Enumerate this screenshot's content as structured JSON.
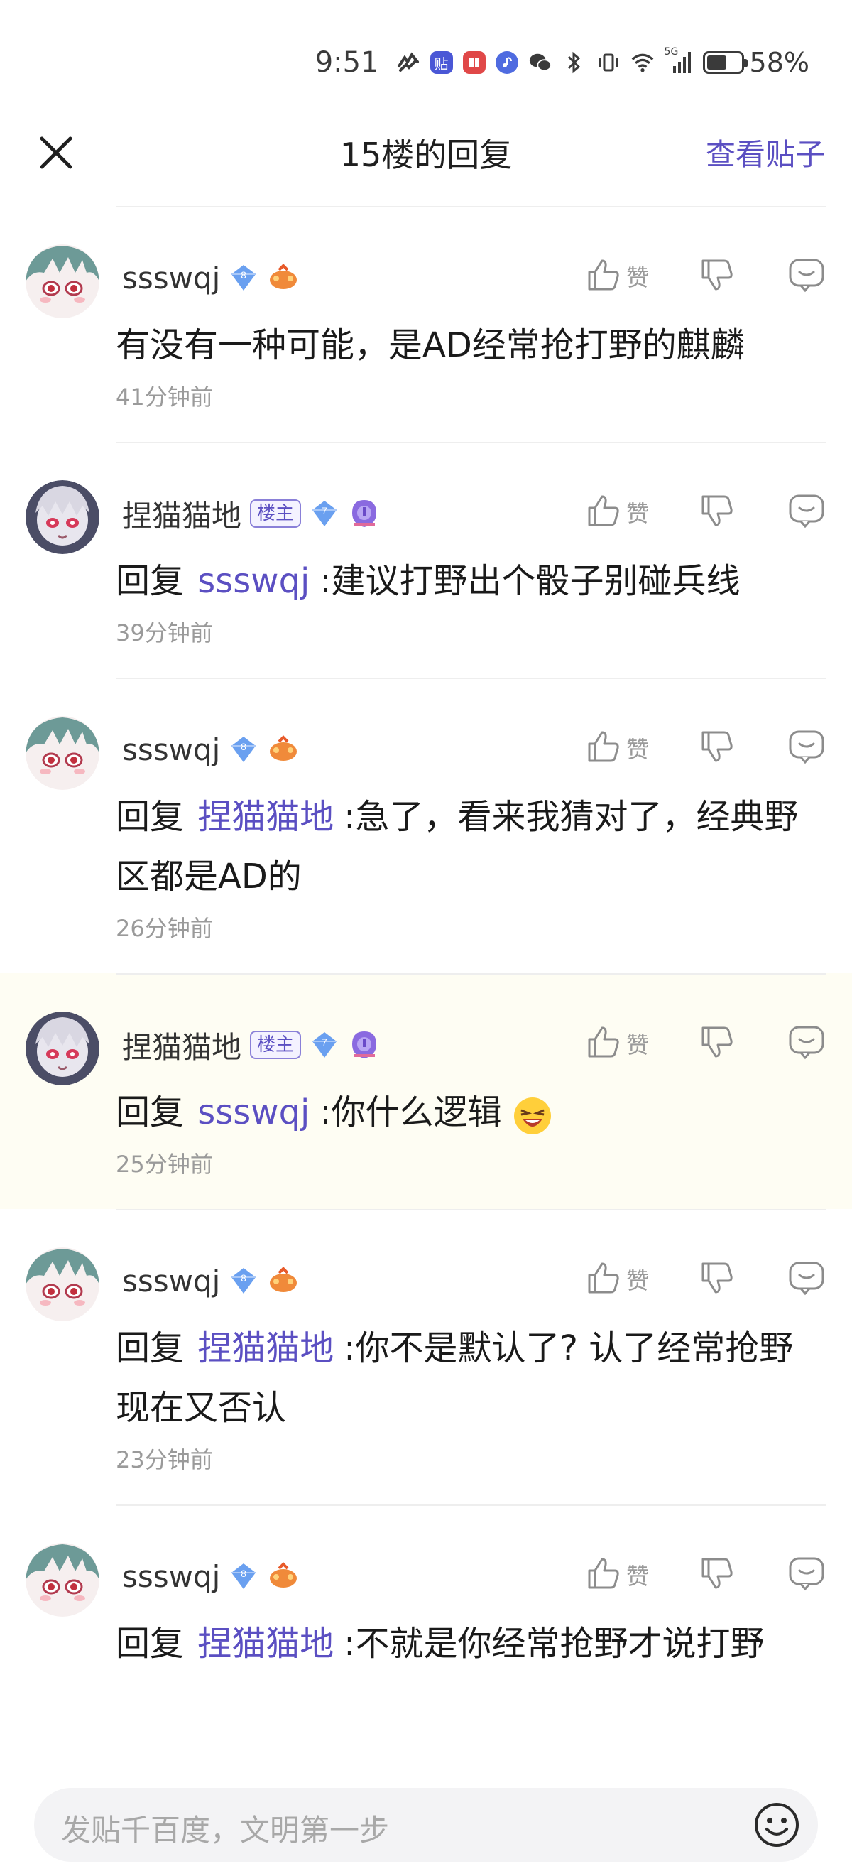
{
  "status_bar": {
    "time": "9:51",
    "battery_percent": "58%",
    "battery_level": 0.58,
    "signal_label": "5G",
    "app_badge_label": "贴",
    "icons": [
      "paw-icon",
      "tieba-app-icon",
      "book-app-icon",
      "music-app-icon",
      "wechat-icon",
      "bluetooth-icon",
      "vibrate-icon",
      "wifi-icon",
      "signal-icon",
      "battery-icon"
    ]
  },
  "header": {
    "title": "15楼的回复",
    "view_post_label": "查看贴子"
  },
  "colors": {
    "accent": "#5b4fc2",
    "highlight_bg": "#fefdf3"
  },
  "replies": [
    {
      "username": "ssswqj",
      "is_host": false,
      "level": "8",
      "reply_prefix": "",
      "mention": "",
      "text": "有没有一种可能，是AD经常抢打野的麒麟",
      "time": "41分钟前",
      "like_label": "赞"
    },
    {
      "username": "捏猫猫地",
      "is_host": true,
      "host_label": "楼主",
      "level": "7",
      "reply_prefix": "回复",
      "mention": "ssswqj",
      "text": ":建议打野出个骰子别碰兵线",
      "time": "39分钟前",
      "like_label": "赞"
    },
    {
      "username": "ssswqj",
      "is_host": false,
      "level": "8",
      "reply_prefix": "回复",
      "mention": "捏猫猫地",
      "text": ":急了，看来我猜对了，经典野区都是AD的",
      "time": "26分钟前",
      "like_label": "赞"
    },
    {
      "username": "捏猫猫地",
      "is_host": true,
      "host_label": "楼主",
      "level": "7",
      "reply_prefix": "回复",
      "mention": "ssswqj",
      "text": ":你什么逻辑",
      "emoji": "laughing-emoji",
      "time": "25分钟前",
      "like_label": "赞",
      "highlighted": true
    },
    {
      "username": "ssswqj",
      "is_host": false,
      "level": "8",
      "reply_prefix": "回复",
      "mention": "捏猫猫地",
      "text": ":你不是默认了? 认了经常抢野现在又否认",
      "time": "23分钟前",
      "like_label": "赞"
    },
    {
      "username": "ssswqj",
      "is_host": false,
      "level": "8",
      "reply_prefix": "回复",
      "mention": "捏猫猫地",
      "text": ":不就是你经常抢野才说打野",
      "time": "",
      "like_label": "赞"
    }
  ],
  "input_bar": {
    "placeholder": "发贴千百度，文明第一步"
  }
}
